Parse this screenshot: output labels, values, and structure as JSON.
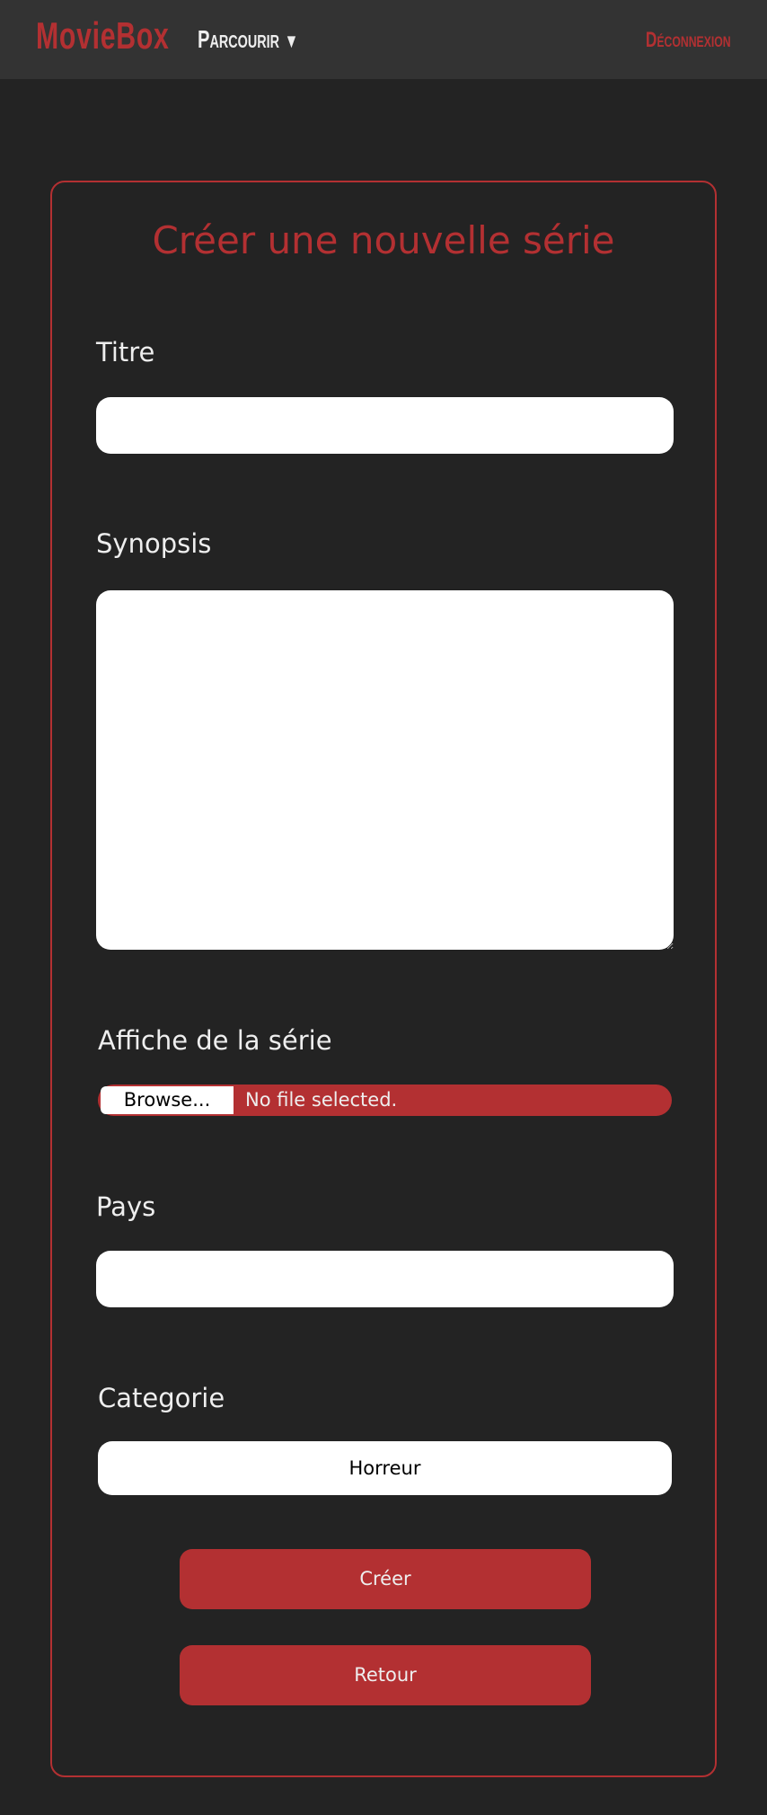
{
  "header": {
    "logo": "MovieBox",
    "browse": "Parcourir",
    "browse_arrow": "▼",
    "logout": "Déconnexion"
  },
  "form": {
    "title": "Créer une nouvelle série",
    "titre_label": "Titre",
    "titre_value": "",
    "synopsis_label": "Synopsis",
    "synopsis_value": "",
    "affiche_label": "Affiche de la série",
    "browse_button": "Browse...",
    "file_status": "No file selected.",
    "pays_label": "Pays",
    "pays_value": "",
    "categorie_label": "Categorie",
    "categorie_selected": "Horreur",
    "create_button": "Créer",
    "back_button": "Retour"
  },
  "colors": {
    "accent": "#b33032",
    "background": "#232323",
    "header": "#333333"
  }
}
